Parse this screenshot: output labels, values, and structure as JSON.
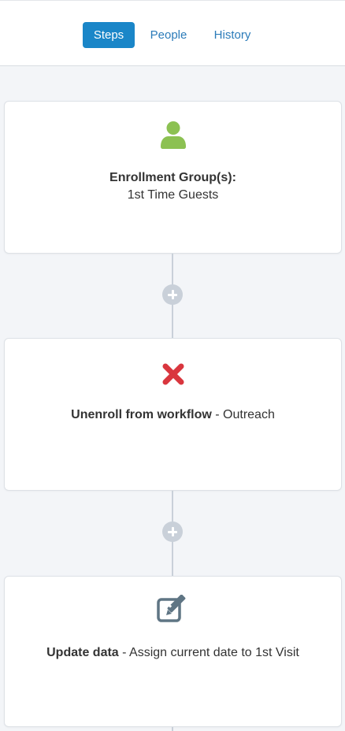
{
  "tabs": {
    "steps": "Steps",
    "people": "People",
    "history": "History",
    "active": "Steps"
  },
  "steps": [
    {
      "icon": "person-icon",
      "icon_color": "#8cc152",
      "title": "Enrollment Group(s):",
      "detail": "1st Time Guests"
    },
    {
      "icon": "red-x-icon",
      "icon_color": "#d9363e",
      "title": "Unenroll from workflow",
      "detail": " - Outreach"
    },
    {
      "icon": "edit-icon",
      "icon_color": "#5f7584",
      "title": "Update data",
      "detail": " - Assign current date to 1st Visit"
    }
  ],
  "colors": {
    "accent": "#1a86c8",
    "link": "#2b7bb9",
    "connector": "#c9d0d9",
    "background": "#f3f5f8"
  }
}
